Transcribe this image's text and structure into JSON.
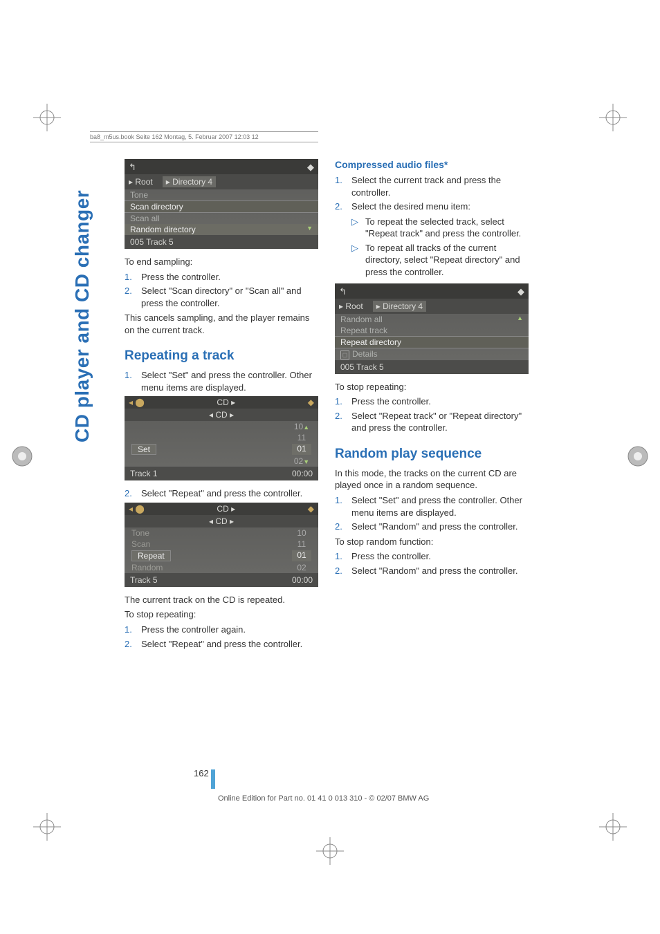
{
  "header": "ba8_m5us.book  Seite 162  Montag, 5. Februar 2007  12:03 12",
  "sideTab": "CD player and CD changer",
  "left": {
    "ss1": {
      "back": "↰",
      "dot": "◆",
      "bc1": "▸ Root",
      "bc2": "▸ Directory 4",
      "r1": "Tone",
      "r2": "Scan directory",
      "r3": "Scan all",
      "r4": "Random directory",
      "footer": "005 Track 5"
    },
    "p1": "To end sampling:",
    "s1n": "1.",
    "s1": "Press the controller.",
    "s2n": "2.",
    "s2": "Select \"Scan directory\" or \"Scan all\" and press the controller.",
    "p2": "This cancels sampling, and the player remains on the current track.",
    "h1": "Repeating a track",
    "s3n": "1.",
    "s3": "Select \"Set\" and press the controller. Other menu items are displayed.",
    "ss2": {
      "hdrL": "◂ ⬤",
      "hdr": "CD",
      "hdrR": "▸",
      "hdrDot": "◆",
      "sub": "◂  CD  ▸",
      "n1": "10",
      "tri1": "▲",
      "n2": "11",
      "setLabel": "Set",
      "n3": "01",
      "n4": "02",
      "tri2": "▼",
      "footL": "Track 1",
      "footR": "00:00"
    },
    "s4n": "2.",
    "s4": "Select \"Repeat\" and press the controller.",
    "ss3": {
      "hdrL": "◂ ⬤",
      "hdr": "CD",
      "hdrR": "▸",
      "hdrDot": "◆",
      "sub": "◂  CD  ▸",
      "r1": "Tone",
      "n1": "10",
      "r2": "Scan",
      "n2": "11",
      "r3": "Repeat",
      "n3": "01",
      "r4": "Random",
      "n4": "02",
      "footL": "Track 5",
      "footR": "00:00"
    },
    "p3": "The current track on the CD is repeated.",
    "p4": "To stop repeating:",
    "s5n": "1.",
    "s5": "Press the controller again.",
    "s6n": "2.",
    "s6": "Select \"Repeat\" and press the controller."
  },
  "right": {
    "h1": "Compressed audio files*",
    "s1n": "1.",
    "s1": "Select the current track and press the controller.",
    "s2n": "2.",
    "s2": "Select the desired menu item:",
    "b1t": "▷",
    "b1": "To repeat the selected track, select \"Repeat track\" and press the controller.",
    "b2t": "▷",
    "b2": "To repeat all tracks of the current directory, select \"Repeat directory\" and press the controller.",
    "ss1": {
      "back": "↰",
      "dot": "◆",
      "bc1": "▸ Root",
      "bc2": "▸ Directory 4",
      "r1": "Random all",
      "r2": "Repeat track",
      "r3": "Repeat directory",
      "r4": "Details",
      "footer": "005 Track 5"
    },
    "p1": "To stop repeating:",
    "s3n": "1.",
    "s3": "Press the controller.",
    "s4n": "2.",
    "s4": "Select \"Repeat track\" or \"Repeat directory\" and press the controller.",
    "h2": "Random play sequence",
    "p2": "In this mode, the tracks on the current CD are played once in a random sequence.",
    "s5n": "1.",
    "s5": "Select \"Set\" and press the controller. Other menu items are displayed.",
    "s6n": "2.",
    "s6": "Select \"Random\" and press the controller.",
    "p3": "To stop random function:",
    "s7n": "1.",
    "s7": "Press the controller.",
    "s8n": "2.",
    "s8": "Select \"Random\" and press the controller."
  },
  "pageNum": "162",
  "footer": "Online Edition for Part no. 01 41 0 013 310 - © 02/07 BMW AG"
}
